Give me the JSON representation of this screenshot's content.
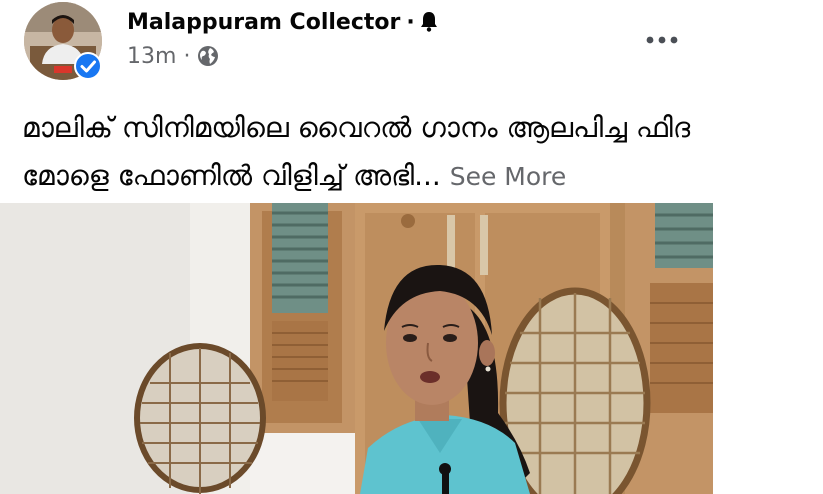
{
  "post": {
    "author": "Malappuram Collector",
    "separator": "·",
    "timestamp": "13m",
    "meta_separator": "·",
    "text": "മാലിക് സിനിമയിലെ  വൈറൽ ഗാനം ആലപിച്ച ഫിദ മോളെ ഫോണിൽ വിളിച്ച് അഭി...",
    "see_more": "See More",
    "icons": {
      "avatar": "profile-photo",
      "verified": "verified-badge-icon",
      "notification": "bell-icon",
      "audience": "globe-icon",
      "options": "more-options-icon"
    }
  },
  "colors": {
    "name_text": "#050505",
    "meta_text": "#65676b",
    "verified_blue": "#1877f2",
    "background": "#ffffff"
  }
}
